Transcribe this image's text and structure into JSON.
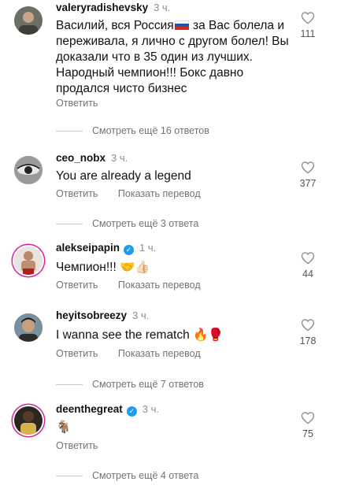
{
  "comments": [
    {
      "username": "valeryradishevsky",
      "time": "3 ч.",
      "verified": false,
      "text_before_flag": "Василий, вся Россия",
      "text_after_flag": " за Вас болела и переживала, я лично с другом болел! Вы доказали что в 35 один из лучших. Народный чемпион!!! Бокс давно продался чисто бизнес",
      "reply_label": "Ответить",
      "translate_label": "",
      "likes": "111",
      "more_replies": "Смотреть ещё 16 ответов"
    },
    {
      "username": "ceo_nobx",
      "time": "3 ч.",
      "verified": false,
      "text": "You are already a legend",
      "reply_label": "Ответить",
      "translate_label": "Показать перевод",
      "likes": "377",
      "more_replies": "Смотреть ещё 3 ответа"
    },
    {
      "username": "alekseipapin",
      "time": "1 ч.",
      "verified": true,
      "text": "Чемпион!!! 🤝👍🏻",
      "reply_label": "Ответить",
      "translate_label": "Показать перевод",
      "likes": "44",
      "more_replies": ""
    },
    {
      "username": "heyitsobreezy",
      "time": "3 ч.",
      "verified": false,
      "text": "I wanna see the rematch 🔥🥊",
      "reply_label": "Ответить",
      "translate_label": "Показать перевод",
      "likes": "178",
      "more_replies": "Смотреть ещё 7 ответов"
    },
    {
      "username": "deenthegreat",
      "time": "3 ч.",
      "verified": true,
      "text": "🐐",
      "reply_label": "Ответить",
      "translate_label": "",
      "likes": "75",
      "more_replies": "Смотреть ещё 4 ответа"
    }
  ],
  "colors": {
    "username": "#111111",
    "secondary": "#737373",
    "verified": "#1d9bf0",
    "story_ring": "#d6249f"
  }
}
